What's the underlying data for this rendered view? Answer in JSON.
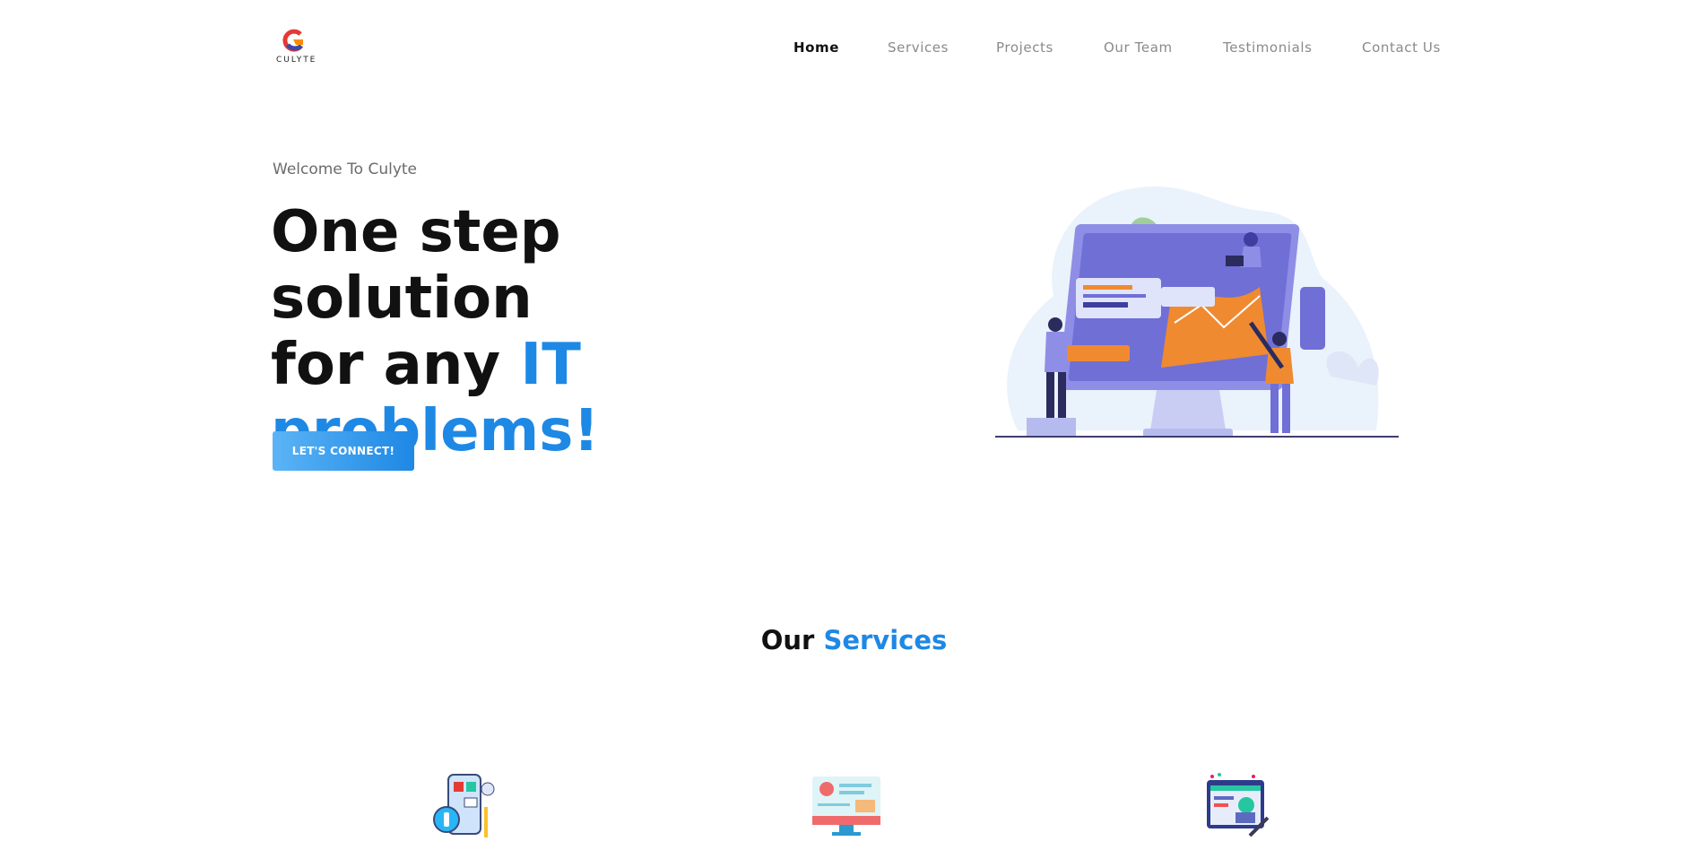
{
  "brand": {
    "name": "CULYTE"
  },
  "nav": {
    "items": [
      {
        "label": "Home",
        "active": true
      },
      {
        "label": "Services",
        "active": false
      },
      {
        "label": "Projects",
        "active": false
      },
      {
        "label": "Our Team",
        "active": false
      },
      {
        "label": "Testimonials",
        "active": false
      },
      {
        "label": "Contact Us",
        "active": false
      }
    ]
  },
  "hero": {
    "welcome": "Welcome To Culyte",
    "title_line1": "One step solution",
    "title_line2_plain": "for any ",
    "title_line2_accent": "IT",
    "title_line3_accent": "problems!",
    "cta_label": "LET'S CONNECT!"
  },
  "services": {
    "title_plain": "Our ",
    "title_accent": "Services",
    "icons": [
      "mobile-app-development-icon",
      "web-design-monitor-icon",
      "ui-design-icon"
    ]
  },
  "colors": {
    "accent": "#1e88e5",
    "text": "#111111",
    "muted": "#8a8a8a",
    "illustration_bg": "#eaf2fc",
    "illustration_screen": "#6f6fd6",
    "illustration_orange": "#f08a30"
  }
}
